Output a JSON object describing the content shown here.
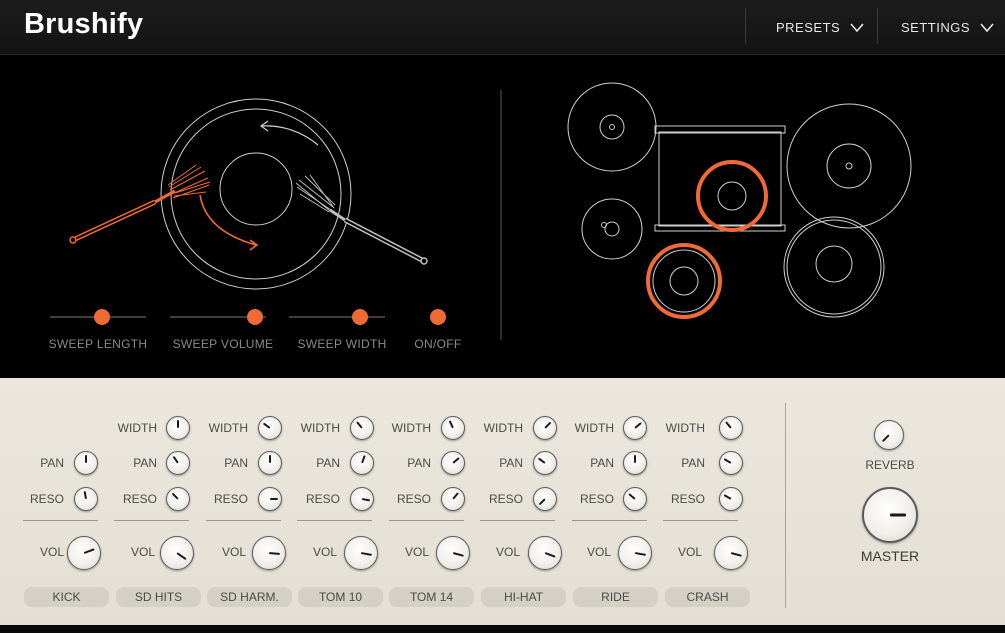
{
  "header": {
    "title": "Brushify",
    "presets_label": "PRESETS",
    "settings_label": "SETTINGS"
  },
  "brush_panel": {
    "controls": [
      {
        "label": "SWEEP LENGTH"
      },
      {
        "label": "SWEEP VOLUME"
      },
      {
        "label": "SWEEP WIDTH"
      },
      {
        "label": "ON/OFF"
      }
    ],
    "accent_color": "#f06a35"
  },
  "mixer": {
    "row_labels": {
      "width": "WIDTH",
      "pan": "PAN",
      "reso": "RESO",
      "vol": "VOL"
    },
    "channels": [
      {
        "name": "KICK"
      },
      {
        "name": "SD HITS"
      },
      {
        "name": "SD HARM."
      },
      {
        "name": "TOM 10"
      },
      {
        "name": "TOM 14"
      },
      {
        "name": "HI-HAT"
      },
      {
        "name": "RIDE"
      },
      {
        "name": "CRASH"
      }
    ],
    "reverb_label": "REVERB",
    "master_label": "MASTER"
  }
}
